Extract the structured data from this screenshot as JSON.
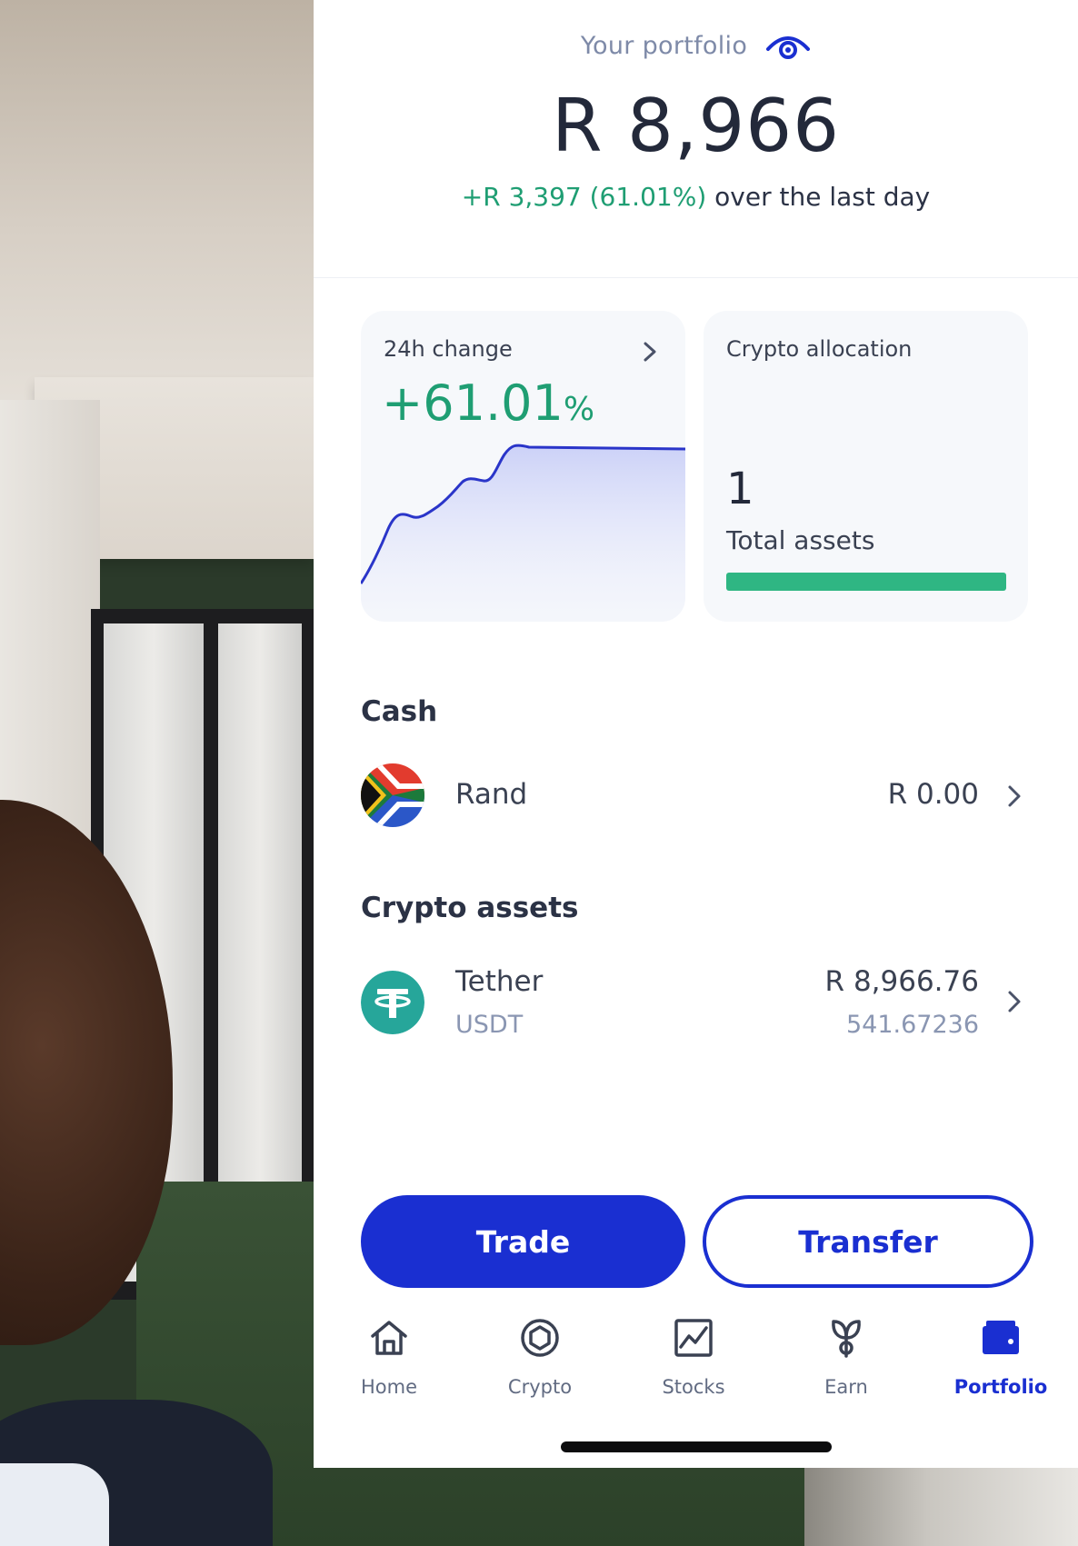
{
  "portfolio": {
    "label": "Your portfolio",
    "total_value": "R 8,966",
    "change_amount": "+R 3,397 (61.01%)",
    "change_period": " over the last day"
  },
  "cards": {
    "change": {
      "title": "24h change",
      "value": "+61.01",
      "unit": "%"
    },
    "allocation": {
      "title": "Crypto allocation",
      "count": "1",
      "count_label": "Total assets",
      "fill_fraction": 1.0
    }
  },
  "cash": {
    "title": "Cash",
    "items": [
      {
        "name": "Rand",
        "value": "R 0.00",
        "icon": "south-africa-flag-icon"
      }
    ]
  },
  "crypto": {
    "title": "Crypto assets",
    "items": [
      {
        "name": "Tether",
        "symbol": "USDT",
        "value": "R 8,966.76",
        "amount": "541.67236",
        "icon": "tether-icon"
      }
    ]
  },
  "actions": {
    "trade": "Trade",
    "transfer": "Transfer"
  },
  "nav": {
    "items": [
      {
        "label": "Home",
        "icon": "home-icon"
      },
      {
        "label": "Crypto",
        "icon": "crypto-icon"
      },
      {
        "label": "Stocks",
        "icon": "stocks-icon"
      },
      {
        "label": "Earn",
        "icon": "earn-icon"
      },
      {
        "label": "Portfolio",
        "icon": "wallet-icon",
        "active": true
      }
    ]
  },
  "colors": {
    "accent": "#1a2fd1",
    "positive": "#1f9e73",
    "bar": "#2fb683"
  }
}
